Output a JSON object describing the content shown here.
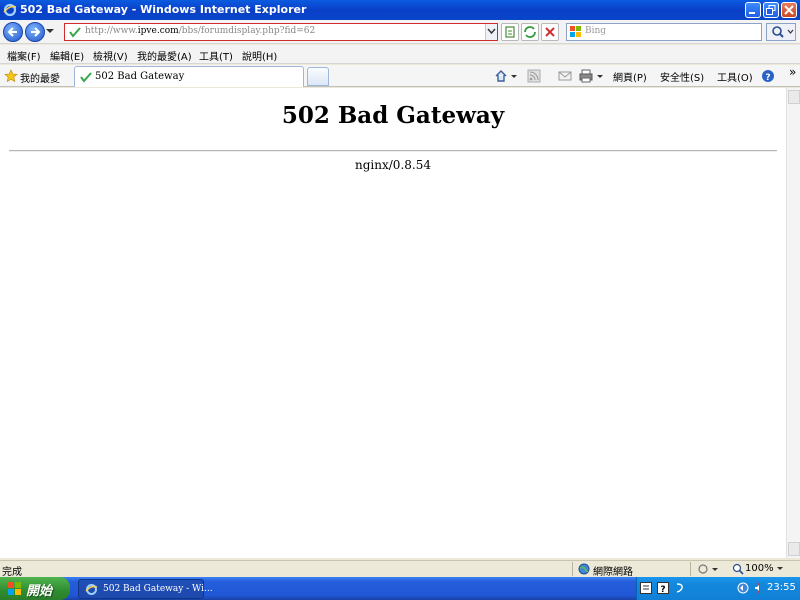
{
  "window": {
    "title": "502 Bad Gateway - Windows Internet Explorer"
  },
  "address_bar": {
    "url_prefix": "http://www.",
    "url_domain": "ipve.com",
    "url_path": "/bbs/forumdisplay.php?fid=62"
  },
  "search": {
    "placeholder": "Bing"
  },
  "menu": {
    "items": [
      "檔案(F)",
      "編輯(E)",
      "檢視(V)",
      "我的最愛(A)",
      "工具(T)",
      "說明(H)"
    ]
  },
  "favorites": {
    "label": "我的最愛"
  },
  "tab": {
    "label": "502 Bad Gateway"
  },
  "command_bar": {
    "page": "網頁(P)",
    "safety": "安全性(S)",
    "tools": "工具(O)",
    "more": "»"
  },
  "content": {
    "heading": "502 Bad Gateway",
    "server": "nginx/0.8.54"
  },
  "status_bar": {
    "status": "完成",
    "zone": "網際網路",
    "zoom": "100%"
  },
  "taskbar": {
    "start_label": "開始",
    "task_label": "502 Bad Gateway - Wi...",
    "clock": "23:55"
  },
  "colors": {
    "titlebar": "#0a4ad0",
    "address_border": "#d12c2c",
    "start_button": "#2f8d2f",
    "taskbar": "#245edb"
  }
}
